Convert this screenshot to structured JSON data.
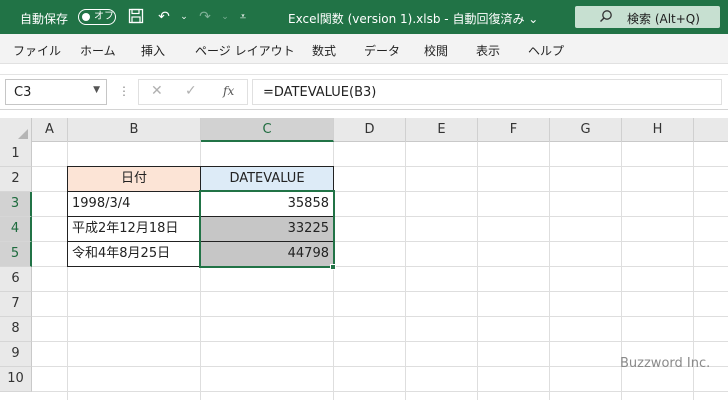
{
  "titlebar": {
    "autosave_label": "自動保存",
    "autosave_state": "オフ",
    "filename": "Excel関数 (version 1).xlsb  -  自動回復済み  ⌄",
    "search_label": "検索 (Alt+Q)",
    "bg_color": "#217346"
  },
  "ribbon": {
    "tabs": [
      "ファイル",
      "ホーム",
      "挿入",
      "ページ レイアウト",
      "数式",
      "データ",
      "校閲",
      "表示",
      "ヘルプ"
    ]
  },
  "formula_bar": {
    "name_box": "C3",
    "formula": "=DATEVALUE(B3)",
    "fx": "fx"
  },
  "columns": [
    "A",
    "B",
    "C",
    "D",
    "E",
    "F",
    "G",
    "H"
  ],
  "rows": [
    "1",
    "2",
    "3",
    "4",
    "5",
    "6",
    "7",
    "8",
    "9",
    "10"
  ],
  "table": {
    "header": {
      "b": "日付",
      "c": "DATEVALUE"
    },
    "rows": [
      {
        "b": "1998/3/4",
        "c": "35858"
      },
      {
        "b": "平成2年12月18日",
        "c": "33225"
      },
      {
        "b": "令和4年8月25日",
        "c": "44798"
      }
    ]
  },
  "watermark": "Buzzword Inc."
}
